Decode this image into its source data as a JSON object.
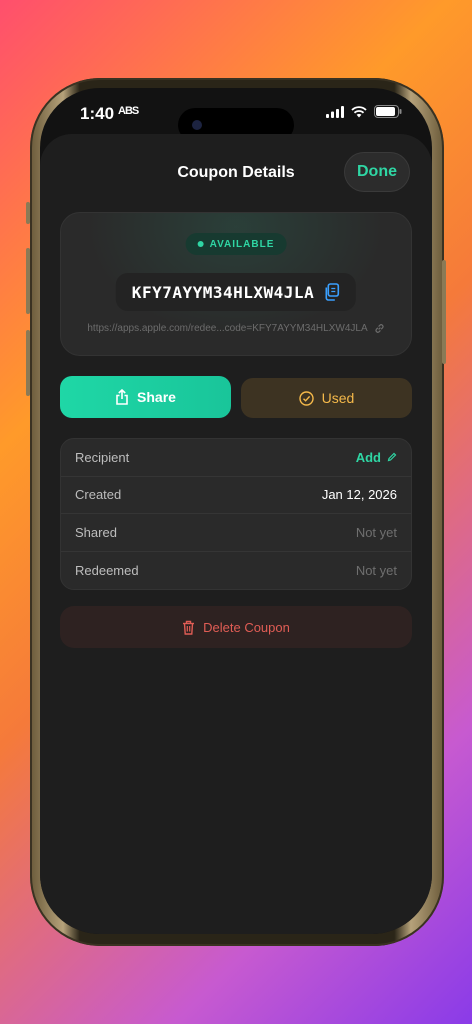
{
  "status": {
    "time": "1:40",
    "time_extra": "ABS"
  },
  "sheet": {
    "title": "Coupon Details",
    "done_label": "Done"
  },
  "coupon": {
    "badge": "AVAILABLE",
    "code": "KFY7AYYM34HLXW4JLA",
    "url": "https://apps.apple.com/redee...code=KFY7AYYM34HLXW4JLA"
  },
  "actions": {
    "share_label": "Share",
    "used_label": "Used"
  },
  "details": [
    {
      "label": "Recipient",
      "value": "Add"
    },
    {
      "label": "Created",
      "value": "Jan 12, 2026"
    },
    {
      "label": "Shared",
      "value": "Not yet"
    },
    {
      "label": "Redeemed",
      "value": "Not yet"
    }
  ],
  "delete_label": "Delete Coupon",
  "colors": {
    "accent": "#2fd6a4",
    "used": "#f5b94a",
    "danger": "#e05d55"
  }
}
